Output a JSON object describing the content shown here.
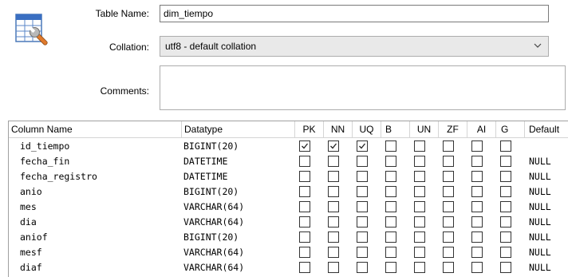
{
  "form": {
    "table_name_label": "Table Name:",
    "table_name_value": "dim_tiempo",
    "collation_label": "Collation:",
    "collation_value": "utf8 - default collation",
    "comments_label": "Comments:"
  },
  "grid": {
    "headers": {
      "column_name": "Column Name",
      "datatype": "Datatype",
      "pk": "PK",
      "nn": "NN",
      "uq": "UQ",
      "b": "B",
      "un": "UN",
      "zf": "ZF",
      "ai": "AI",
      "g": "G",
      "default": "Default"
    },
    "rows": [
      {
        "name": "id_tiempo",
        "type": "BIGINT(20)",
        "default": "",
        "flags": [
          true,
          true,
          true,
          false,
          false,
          false,
          false,
          false
        ]
      },
      {
        "name": "fecha_fin",
        "type": "DATETIME",
        "default": "NULL",
        "flags": [
          false,
          false,
          false,
          false,
          false,
          false,
          false,
          false
        ]
      },
      {
        "name": "fecha_registro",
        "type": "DATETIME",
        "default": "NULL",
        "flags": [
          false,
          false,
          false,
          false,
          false,
          false,
          false,
          false
        ]
      },
      {
        "name": "anio",
        "type": "BIGINT(20)",
        "default": "NULL",
        "flags": [
          false,
          false,
          false,
          false,
          false,
          false,
          false,
          false
        ]
      },
      {
        "name": "mes",
        "type": "VARCHAR(64)",
        "default": "NULL",
        "flags": [
          false,
          false,
          false,
          false,
          false,
          false,
          false,
          false
        ]
      },
      {
        "name": "dia",
        "type": "VARCHAR(64)",
        "default": "NULL",
        "flags": [
          false,
          false,
          false,
          false,
          false,
          false,
          false,
          false
        ]
      },
      {
        "name": "aniof",
        "type": "BIGINT(20)",
        "default": "NULL",
        "flags": [
          false,
          false,
          false,
          false,
          false,
          false,
          false,
          false
        ]
      },
      {
        "name": "mesf",
        "type": "VARCHAR(64)",
        "default": "NULL",
        "flags": [
          false,
          false,
          false,
          false,
          false,
          false,
          false,
          false
        ]
      },
      {
        "name": "diaf",
        "type": "VARCHAR(64)",
        "default": "NULL",
        "flags": [
          false,
          false,
          false,
          false,
          false,
          false,
          false,
          false
        ]
      }
    ]
  },
  "icons": {
    "table": "table-settings-icon",
    "dropdown": "chevron-down-icon",
    "check": "check-icon"
  }
}
